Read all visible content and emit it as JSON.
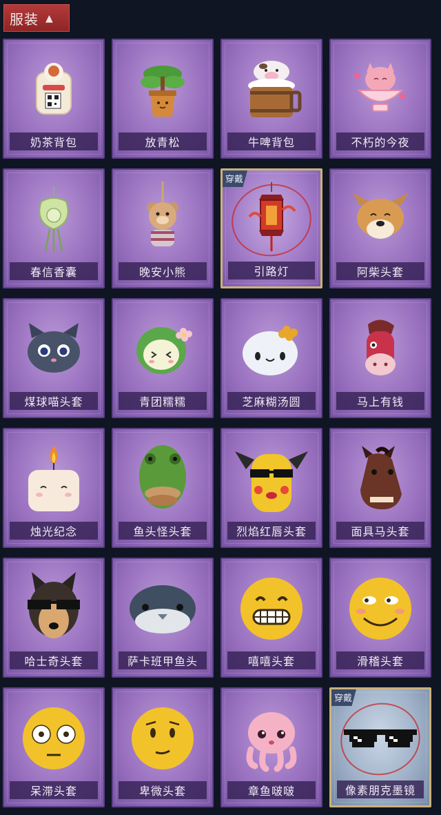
{
  "header": {
    "label": "服装",
    "chevron_icon": "chevron-up-icon"
  },
  "worn_label": "穿戴",
  "items": [
    {
      "name": "奶茶背包",
      "icon": "milk-tea-backpack-icon"
    },
    {
      "name": "放青松",
      "icon": "potted-pine-icon"
    },
    {
      "name": "牛啤背包",
      "icon": "cow-beer-backpack-icon"
    },
    {
      "name": "不朽的今夜",
      "icon": "pink-cat-bowl-icon"
    },
    {
      "name": "春信香囊",
      "icon": "green-sachet-icon"
    },
    {
      "name": "晚安小熊",
      "icon": "teddy-bear-charm-icon"
    },
    {
      "name": "引路灯",
      "icon": "red-lantern-icon",
      "worn": true
    },
    {
      "name": "阿柴头套",
      "icon": "shiba-mask-icon"
    },
    {
      "name": "煤球喵头套",
      "icon": "black-cat-mask-icon"
    },
    {
      "name": "青团糯糯",
      "icon": "green-dumpling-icon"
    },
    {
      "name": "芝麻糊汤圆",
      "icon": "white-rice-ball-icon"
    },
    {
      "name": "马上有钱",
      "icon": "red-horse-mask-icon"
    },
    {
      "name": "烛光纪念",
      "icon": "candle-icon"
    },
    {
      "name": "鱼头怪头套",
      "icon": "fish-head-mask-icon"
    },
    {
      "name": "烈焰红唇头套",
      "icon": "yellow-pikachu-mask-icon"
    },
    {
      "name": "面具马头套",
      "icon": "horse-mask-icon"
    },
    {
      "name": "哈士奇头套",
      "icon": "husky-mask-icon"
    },
    {
      "name": "萨卡班甲鱼头",
      "icon": "fish-head-icon"
    },
    {
      "name": "嘻嘻头套",
      "icon": "grin-emoji-mask-icon"
    },
    {
      "name": "滑稽头套",
      "icon": "funny-emoji-mask-icon"
    },
    {
      "name": "呆滞头套",
      "icon": "stunned-emoji-mask-icon"
    },
    {
      "name": "卑微头套",
      "icon": "humble-emoji-mask-icon"
    },
    {
      "name": "章鱼啵啵",
      "icon": "pink-octopus-icon"
    },
    {
      "name": "像素朋克墨镜",
      "icon": "pixel-sunglasses-icon",
      "worn": true
    }
  ],
  "colors": {
    "background": "#101523",
    "card_purple": "#9a72c0",
    "card_blue": "#9fb1c8",
    "header_red": "#a33030",
    "worn_circle": "#c82828"
  }
}
